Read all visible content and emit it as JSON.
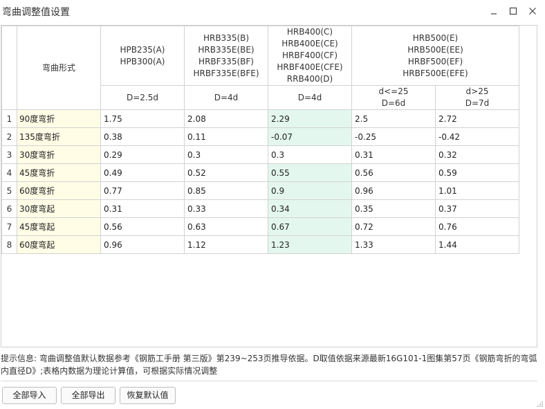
{
  "window": {
    "title": "弯曲调整值设置"
  },
  "columns": {
    "name_header": "弯曲形式",
    "group_a": {
      "lines": [
        "HPB235(A)",
        "HPB300(A)"
      ],
      "sub": "D=2.5d"
    },
    "group_b": {
      "lines": [
        "HRB335(B)",
        "HRB335E(BE)",
        "HRBF335(BF)",
        "HRBF335E(BFE)"
      ],
      "sub": "D=4d"
    },
    "group_c": {
      "lines": [
        "HRB400(C)",
        "HRB400E(CE)",
        "HRBF400(CF)",
        "HRBF400E(CFE)",
        "RRB400(D)"
      ],
      "sub": "D=4d"
    },
    "group_d": {
      "lines": [
        "HRB500(E)",
        "HRB500E(EE)",
        "HRBF500(EF)",
        "HRBF500E(EFE)"
      ],
      "sub1": [
        "d<=25",
        "D=6d"
      ],
      "sub2": [
        "d>25",
        "D=7d"
      ]
    }
  },
  "rows": [
    {
      "num": "1",
      "name": "90度弯折",
      "a": "1.75",
      "b": "2.08",
      "c": "2.29",
      "d1": "2.5",
      "d2": "2.72"
    },
    {
      "num": "2",
      "name": "135度弯折",
      "a": "0.38",
      "b": "0.11",
      "c": "-0.07",
      "d1": "-0.25",
      "d2": "-0.42"
    },
    {
      "num": "3",
      "name": "30度弯折",
      "a": "0.29",
      "b": "0.3",
      "c": "0.3",
      "d1": "0.31",
      "d2": "0.32"
    },
    {
      "num": "4",
      "name": "45度弯折",
      "a": "0.49",
      "b": "0.52",
      "c": "0.55",
      "d1": "0.56",
      "d2": "0.59"
    },
    {
      "num": "5",
      "name": "60度弯折",
      "a": "0.77",
      "b": "0.85",
      "c": "0.9",
      "d1": "0.96",
      "d2": "1.01"
    },
    {
      "num": "6",
      "name": "30度弯起",
      "a": "0.31",
      "b": "0.33",
      "c": "0.34",
      "d1": "0.35",
      "d2": "0.37"
    },
    {
      "num": "7",
      "name": "45度弯起",
      "a": "0.56",
      "b": "0.63",
      "c": "0.67",
      "d1": "0.72",
      "d2": "0.76"
    },
    {
      "num": "8",
      "name": "60度弯起",
      "a": "0.96",
      "b": "1.12",
      "c": "1.23",
      "d1": "1.33",
      "d2": "1.44"
    }
  ],
  "highlighted_cells": {
    "c": [
      0,
      1,
      3,
      4,
      5,
      6,
      7
    ]
  },
  "hint": {
    "line1": "提示信息: 弯曲调整值默认数据参考《钢筋工手册 第三版》第239~253页推导依据。D取值依据来源最新16G101-1图集第57页《钢筋弯折的弯弧",
    "line2": "内直径D》;表格内数据为理论计算值，可根据实际情况调整"
  },
  "buttons": {
    "import_all": "全部导入",
    "export_all": "全部导出",
    "restore_default": "恢复默认值"
  },
  "colors": {
    "name_column_bg": "#fffde6",
    "highlight_bg": "#e3f7ee",
    "border": "#d2d2d2"
  },
  "icons": [
    "minimize-icon",
    "maximize-icon",
    "close-icon",
    "resize-grip-icon"
  ]
}
